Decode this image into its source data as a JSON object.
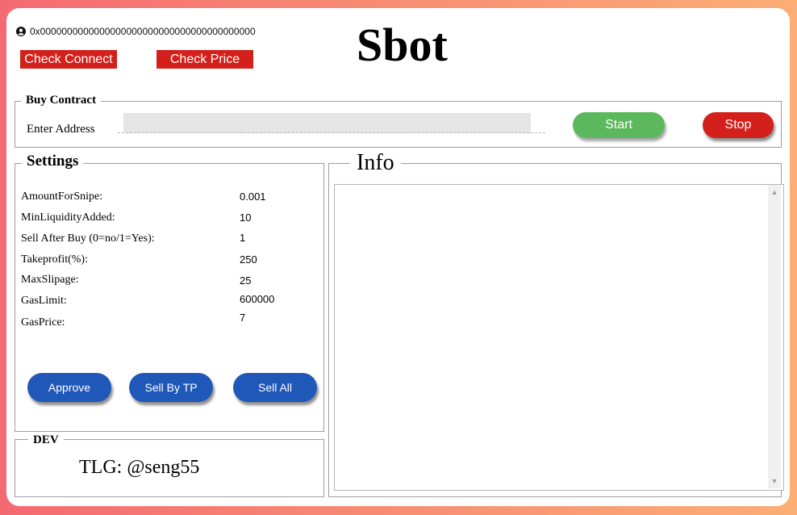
{
  "header": {
    "wallet_address": "0x0000000000000000000000000000000000000000",
    "check_connect_label": "Check Connect",
    "check_price_label": "Check Price",
    "app_title": "Sbot",
    "icons": {
      "wallet": "user-circle-icon"
    }
  },
  "buy_contract": {
    "group_title": "Buy Contract",
    "address_label": "Enter Address",
    "address_value": "",
    "start_label": "Start",
    "stop_label": "Stop"
  },
  "settings": {
    "group_title": "Settings",
    "rows": [
      {
        "label": "AmountForSnipe:",
        "value": "0.001"
      },
      {
        "label": "MinLiquidityAdded:",
        "value": "10"
      },
      {
        "label": "Sell After Buy (0=no/1=Yes):",
        "value": "1"
      },
      {
        "label": "Takeprofit(%):",
        "value": "250"
      },
      {
        "label": "MaxSlipage:",
        "value": "25"
      },
      {
        "label": "GasLimit:",
        "value": "600000"
      },
      {
        "label": "GasPrice:",
        "value": "7"
      }
    ],
    "approve_label": "Approve",
    "sell_by_tp_label": "Sell By TP",
    "sell_all_label": "Sell All"
  },
  "dev": {
    "group_title": "DEV",
    "contact": "TLG: @seng55"
  },
  "info": {
    "group_title": "Info",
    "log_text": ""
  },
  "colors": {
    "red_button": "#d3201a",
    "green_button": "#5cb85c",
    "blue_button": "#1f58b8",
    "background_gradient_start": "#f46a72",
    "background_gradient_end": "#fcae75"
  }
}
